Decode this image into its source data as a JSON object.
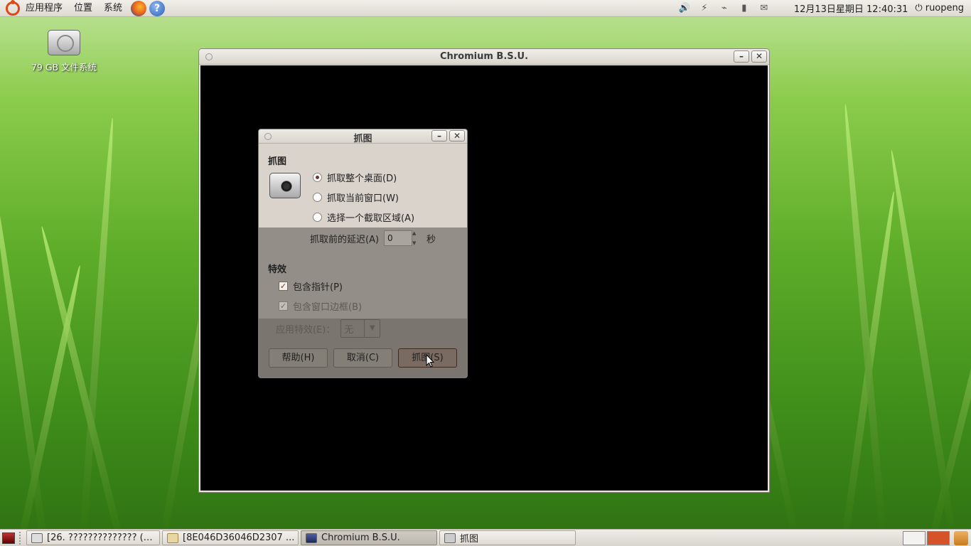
{
  "top_panel": {
    "menus": [
      "应用程序",
      "位置",
      "系统"
    ],
    "clock": "12月13日星期日 12:40:31",
    "user": "ruopeng"
  },
  "desktop": {
    "icon_label": "79 GB 文件系统"
  },
  "main_window": {
    "title": "Chromium B.S.U."
  },
  "dialog": {
    "title": "抓图",
    "grab_section": "抓图",
    "options": [
      {
        "label": "抓取整个桌面(D)",
        "selected": true
      },
      {
        "label": "抓取当前窗口(W)",
        "selected": false
      },
      {
        "label": "选择一个截取区域(A)",
        "selected": false
      }
    ],
    "delay_label": "抓取前的延迟(A)",
    "delay_value": "0",
    "delay_unit": "秒",
    "effects_section": "特效",
    "include_pointer": "包含指针(P)",
    "include_border": "包含窗口边框(B)",
    "apply_effect_label": "应用特效(E)：",
    "apply_effect_value": "无",
    "buttons": {
      "help": "帮助(H)",
      "cancel": "取消(C)",
      "grab": "抓图(S)"
    }
  },
  "taskbar": {
    "tasks": [
      {
        "label": "[26. ?????????????? (…"
      },
      {
        "label": "[8E046D36046D2307 ..."
      },
      {
        "label": "Chromium B.S.U."
      },
      {
        "label": "抓图"
      }
    ]
  }
}
